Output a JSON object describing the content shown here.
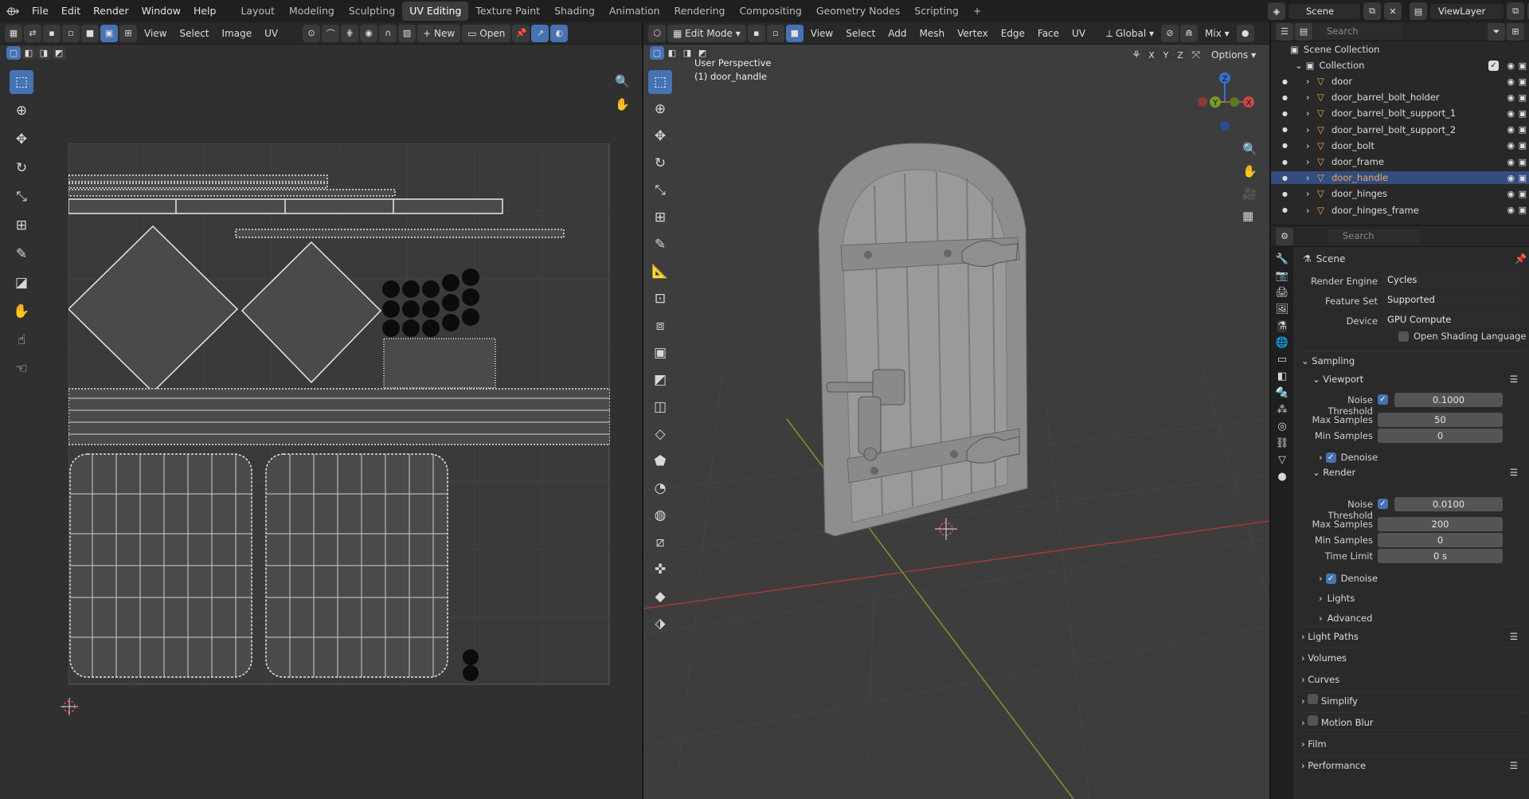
{
  "topbar": {
    "menus": [
      "File",
      "Edit",
      "Render",
      "Window",
      "Help"
    ],
    "workspaces": [
      "Layout",
      "Modeling",
      "Sculpting",
      "UV Editing",
      "Texture Paint",
      "Shading",
      "Animation",
      "Rendering",
      "Compositing",
      "Geometry Nodes",
      "Scripting"
    ],
    "active_workspace": "UV Editing",
    "add_tab": "+",
    "scene_label": "Scene",
    "viewlayer_label": "ViewLayer"
  },
  "uv_editor": {
    "menus": [
      "View",
      "Select",
      "Image",
      "UV"
    ],
    "new_label": "New",
    "open_label": "Open",
    "new_plus": "+"
  },
  "viewport": {
    "mode_label": "Edit Mode",
    "menus": [
      "View",
      "Select",
      "Add",
      "Mesh",
      "Vertex",
      "Edge",
      "Face",
      "UV"
    ],
    "transform_orientation": "Global",
    "proportional_label": "Mix",
    "options_label": "Options",
    "axes": [
      "X",
      "Y",
      "Z"
    ],
    "overlay_title": "User Perspective",
    "overlay_object": "(1) door_handle",
    "gizmo": {
      "x": "X",
      "y": "Y",
      "z": "Z"
    }
  },
  "outliner": {
    "search_placeholder": "Search",
    "root": "Scene Collection",
    "collection": "Collection",
    "items": [
      {
        "name": "door",
        "selected": false
      },
      {
        "name": "door_barrel_bolt_holder",
        "selected": false
      },
      {
        "name": "door_barrel_bolt_support_1",
        "selected": false
      },
      {
        "name": "door_barrel_bolt_support_2",
        "selected": false
      },
      {
        "name": "door_bolt",
        "selected": false
      },
      {
        "name": "door_frame",
        "selected": false
      },
      {
        "name": "door_handle",
        "selected": true
      },
      {
        "name": "door_hinges",
        "selected": false
      },
      {
        "name": "door_hinges_frame",
        "selected": false
      }
    ]
  },
  "properties": {
    "search_placeholder": "Search",
    "context": "Scene",
    "render_engine_label": "Render Engine",
    "render_engine": "Cycles",
    "feature_set_label": "Feature Set",
    "feature_set": "Supported",
    "device_label": "Device",
    "device": "GPU Compute",
    "osl_label": "Open Shading Language",
    "sampling": "Sampling",
    "viewport": "Viewport",
    "noise_threshold_label": "Noise Threshold",
    "vp_noise_threshold": "0.1000",
    "max_samples_label": "Max Samples",
    "vp_max_samples": "50",
    "min_samples_label": "Min Samples",
    "vp_min_samples": "0",
    "denoise_label": "Denoise",
    "render": "Render",
    "r_noise_threshold": "0.0100",
    "r_max_samples": "200",
    "r_min_samples": "0",
    "time_limit_label": "Time Limit",
    "r_time_limit": "0 s",
    "lights": "Lights",
    "advanced": "Advanced",
    "panels": [
      "Light Paths",
      "Volumes",
      "Curves",
      "Simplify",
      "Motion Blur",
      "Film",
      "Performance"
    ]
  },
  "colors": {
    "accent": "#4772b3",
    "selected_text": "#f0a75a",
    "axis_red": "#a23a3a",
    "axis_green": "#7a9a2a"
  }
}
